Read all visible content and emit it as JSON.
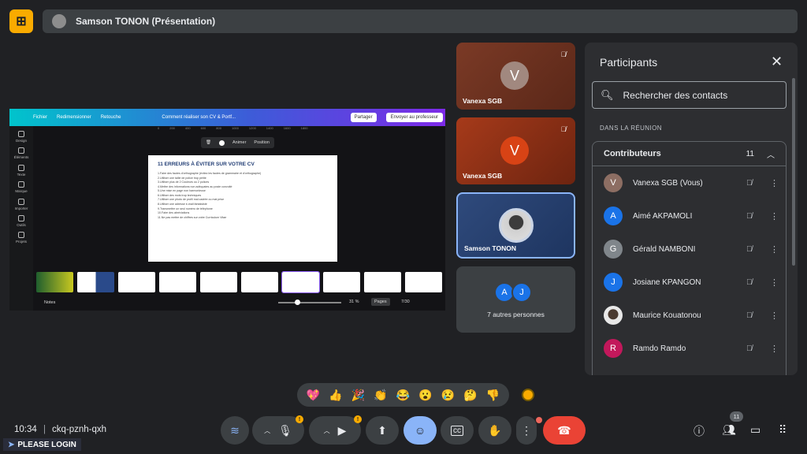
{
  "header": {
    "presenter_title": "Samson TONON (Présentation)"
  },
  "canva": {
    "menu": [
      "Fichier",
      "Redimensionner",
      "Retouche"
    ],
    "doc_title": "Comment réaliser son CV & Portf...",
    "share_label": "Partager",
    "send_label": "Envoyer au professeur",
    "sidebar": [
      "Design",
      "Éléments",
      "Texte",
      "Marque",
      "Importer",
      "Outils",
      "Projets"
    ],
    "ruler": [
      "0",
      "200",
      "400",
      "600",
      "800",
      "1000",
      "1200",
      "1400",
      "1600",
      "1800"
    ],
    "slide_tools": [
      "Animer",
      "Position"
    ],
    "slide_title": "11 ERREURS À ÉVITER SUR VOTRE CV",
    "slide_items": [
      "1.Faire des fautes d'orthographe (évitez les fautes de grammaire et d'orthographe)",
      "2.Utiliser une taille de police trop petite",
      "3.Utiliser plus de 2 Couleurs ou 2 polices",
      "4.Mettre des informations non adéquates au poste convoité",
      "5.Une mise en page non harmonieuse",
      "6.Utiliser des mots trop techniques",
      "7.Utiliser une photo de profil mal cadrée ou mal prise",
      "8.Utiliser une adresse e-mail fantaisiste",
      "9.Transmettre un seul numéro de téléphone",
      "10.Faire des abréviations",
      "11.Ne pas mettre de chiffres sur votre Curriculum Vitae"
    ],
    "notes_label": "Notes",
    "zoom": "31 %",
    "pages_label": "Pages",
    "page_count": "7/30",
    "active_slide": 7
  },
  "tiles": [
    {
      "name": "Vanexa SGB",
      "initial": "V"
    },
    {
      "name": "Vanexa SGB",
      "initial": "V"
    },
    {
      "name": "Samson TONON"
    },
    {
      "initials": [
        "A",
        "J"
      ],
      "label": "7 autres personnes"
    }
  ],
  "panel": {
    "title": "Participants",
    "search_placeholder": "Rechercher des contacts",
    "section_label": "DANS LA RÉUNION",
    "group_name": "Contributeurs",
    "group_count": "11",
    "participants": [
      {
        "name": "Vanexa SGB (Vous)",
        "initial": "V",
        "color": "#8d6e63"
      },
      {
        "name": "Aimé AKPAMOLI",
        "initial": "A",
        "color": "#1a73e8"
      },
      {
        "name": "Gérald NAMBONI",
        "initial": "G",
        "color": "#80868b"
      },
      {
        "name": "Josiane KPANGON",
        "initial": "J",
        "color": "#1a73e8"
      },
      {
        "name": "Maurice Kouatonou",
        "initial": "",
        "color": "#e0e0e0"
      },
      {
        "name": "Ramdo Ramdo",
        "initial": "R",
        "color": "#c2185b"
      }
    ]
  },
  "reactions": [
    "💖",
    "👍",
    "🎉",
    "👏",
    "😂",
    "😮",
    "😢",
    "🤔",
    "👎"
  ],
  "footer": {
    "time": "10:34",
    "separator": "|",
    "meeting_code": "ckq-pznh-qxh",
    "login_label": "PLEASE LOGIN",
    "people_badge": "11"
  }
}
